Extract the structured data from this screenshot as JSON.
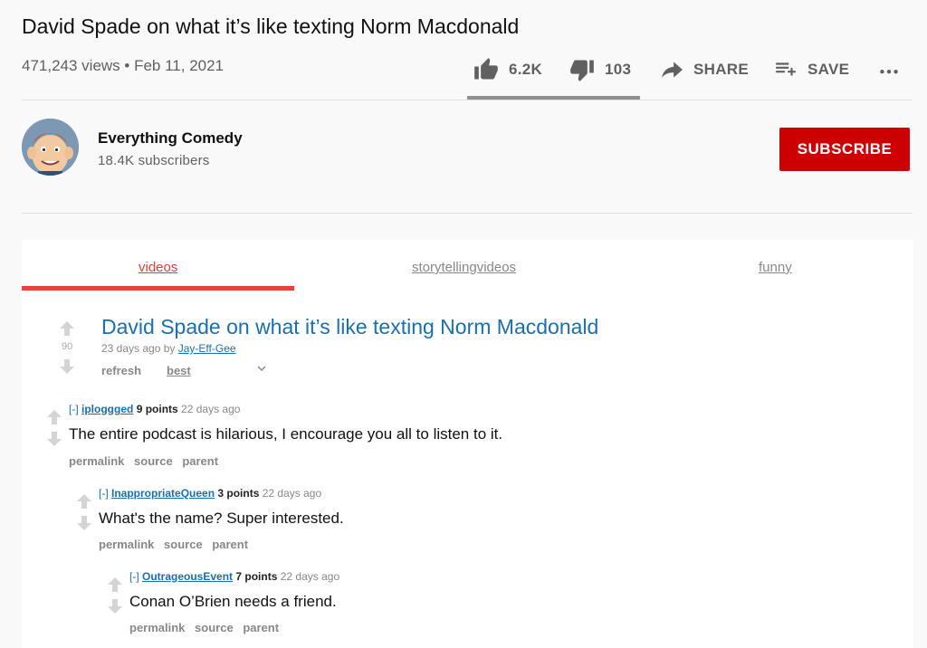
{
  "video": {
    "title": "David Spade on what it’s like texting Norm Macdonald",
    "meta": "471,243 views • Feb 11, 2021",
    "likes": "6.2K",
    "dislikes": "103",
    "share_label": "SHARE",
    "save_label": "SAVE",
    "like_ratio": 0.98
  },
  "channel": {
    "name": "Everything Comedy",
    "subscribers": "18.4K subscribers",
    "subscribe_label": "SUBSCRIBE"
  },
  "tabs": [
    {
      "label": "videos",
      "active": true
    },
    {
      "label": "storytellingvideos",
      "active": false
    },
    {
      "label": "funny",
      "active": false
    }
  ],
  "post": {
    "score": "90",
    "title": "David Spade on what it’s like texting Norm Macdonald",
    "age": "23 days ago by",
    "author": "Jay-Eff-Gee",
    "refresh_label": "refresh",
    "sort_label": "best"
  },
  "comments": [
    {
      "toggle": "[-]",
      "user": "iploggged",
      "points": "9 points",
      "age": "22 days ago",
      "body": "The entire podcast is hilarious, I encourage you all to listen to it.",
      "links": [
        "permalink",
        "source",
        "parent"
      ]
    },
    {
      "toggle": "[-]",
      "user": "InappropriateQueen",
      "points": "3 points",
      "age": "22 days ago",
      "body": "What's the name? Super interested.",
      "links": [
        "permalink",
        "source",
        "parent"
      ]
    },
    {
      "toggle": "[-]",
      "user": "OutrageousEvent",
      "points": "7 points",
      "age": "22 days ago",
      "body": "Conan O’Brien needs a friend.",
      "links": [
        "permalink",
        "source",
        "parent"
      ]
    }
  ],
  "colors": {
    "subscribe": "#cc0000",
    "link_blue": "#1a6fae",
    "active_tab": "#e8413a"
  },
  "icons": [
    "thumbs-up-icon",
    "thumbs-down-icon",
    "share-arrow-icon",
    "playlist-add-icon",
    "more-horizontal-icon",
    "upvote-arrow-icon",
    "downvote-arrow-icon",
    "chevron-down-icon"
  ]
}
